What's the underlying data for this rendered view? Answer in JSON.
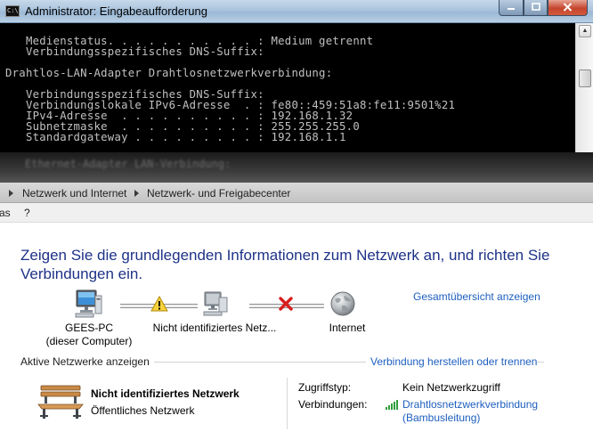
{
  "cmd": {
    "title": "Administrator: Eingabeaufforderung",
    "icon_text": "C:\\",
    "icon": "command-prompt-icon",
    "lines": [
      "   Medienstatus. . . . . . . . . . . : Medium getrennt",
      "   Verbindungsspezifisches DNS-Suffix:",
      "",
      "Drahtlos-LAN-Adapter Drahtlosnetzwerkverbindung:",
      "",
      "   Verbindungsspezifisches DNS-Suffix:",
      "   Verbindungslokale IPv6-Adresse  . : fe80::459:51a8:fe11:9501%21",
      "   IPv4-Adresse  . . . . . . . . . . : 192.168.1.32",
      "   Subnetzmaske  . . . . . . . . . . : 255.255.255.0",
      "   Standardgateway . . . . . . . . . : 192.168.1.1"
    ],
    "blurred_line": "Ethernet-Adapter LAN-Verbindung:"
  },
  "breadcrumb": {
    "items": [
      "Netzwerk und Internet",
      "Netzwerk- und Freigabecenter"
    ]
  },
  "menu": {
    "items": [
      "as",
      "?"
    ]
  },
  "network_center": {
    "heading": "Zeigen Sie die grundlegenden Informationen zum Netzwerk an, und richten Sie Verbindungen ein.",
    "full_map_link": "Gesamtübersicht anzeigen",
    "nodes": {
      "computer": {
        "name": "GEES-PC",
        "sub": "(dieser Computer)",
        "icon": "computer-icon"
      },
      "network": {
        "name": "Nicht identifiziertes Netz...",
        "icon": "network-icon"
      },
      "internet": {
        "name": "Internet",
        "icon": "globe-icon"
      }
    },
    "warning_icon": "warning-icon",
    "error_icon": "red-x-icon",
    "active_networks_label": "Aktive Netzwerke anzeigen",
    "connect_link": "Verbindung herstellen oder trennen",
    "active_network": {
      "name": "Nicht identifiziertes Netzwerk",
      "type": "Öffentliches Netzwerk",
      "icon": "park-bench-icon"
    },
    "properties": {
      "access_label": "Zugriffstyp:",
      "access_value": "Kein Netzwerkzugriff",
      "connections_label": "Verbindungen:",
      "connection_name": "Drahtlosnetzwerkverbindung",
      "connection_sub": "(Bambusleitung)",
      "connection_icon": "signal-bars-icon"
    }
  },
  "colors": {
    "heading": "#1e3287",
    "link": "#1e5fbf",
    "cmd_text": "#c0c0c0",
    "cmd_background": "#000000"
  }
}
